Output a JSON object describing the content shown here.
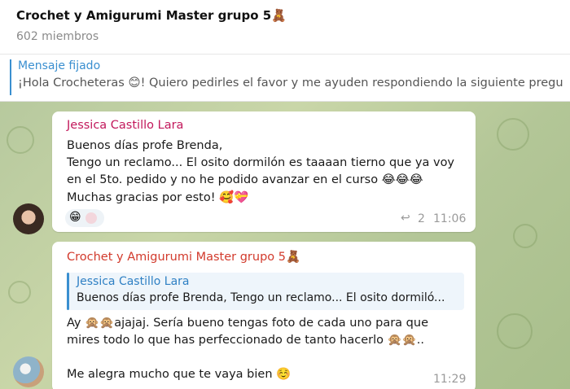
{
  "header": {
    "title": "Crochet y Amigurumi Master grupo 5🧸",
    "subtitle": "602 miembros"
  },
  "pinned": {
    "title": "Mensaje fijado",
    "text": "¡Hola Crocheteras 😊! Quiero pedirles el favor y me ayuden respondiendo la siguiente pregu"
  },
  "messages": [
    {
      "sender": "Jessica Castillo Lara",
      "lines": [
        "Buenos días profe Brenda,",
        "Tengo un reclamo... El osito dormilón es taaaan tierno que ya voy",
        "en el 5to. pedido y no he podido avanzar en el curso 😂😂😂",
        "Muchas gracias por esto! 🥰💝"
      ],
      "reaction_emoji": "😁",
      "reply_icon": "↩",
      "reply_count": "2",
      "time": "11:06"
    },
    {
      "sender": "Crochet y Amigurumi Master grupo 5🧸",
      "quote": {
        "name": "Jessica Castillo Lara",
        "text": "Buenos días profe Brenda, Tengo un reclamo... El osito dormiló..."
      },
      "lines": [
        "Ay 🙊🙊ajajaj. Sería bueno tengas foto de cada uno para que",
        "mires todo lo que has perfeccionado de tanto hacerlo 🙊🙊..",
        "Me alegra mucho que te vaya bien ☺️"
      ],
      "time": "11:29"
    }
  ],
  "colors": {
    "accent": "#3a8fd0",
    "sender_1": "#c2185b",
    "sender_2": "#d23a2c",
    "chat_bg": "#b7c99e"
  }
}
